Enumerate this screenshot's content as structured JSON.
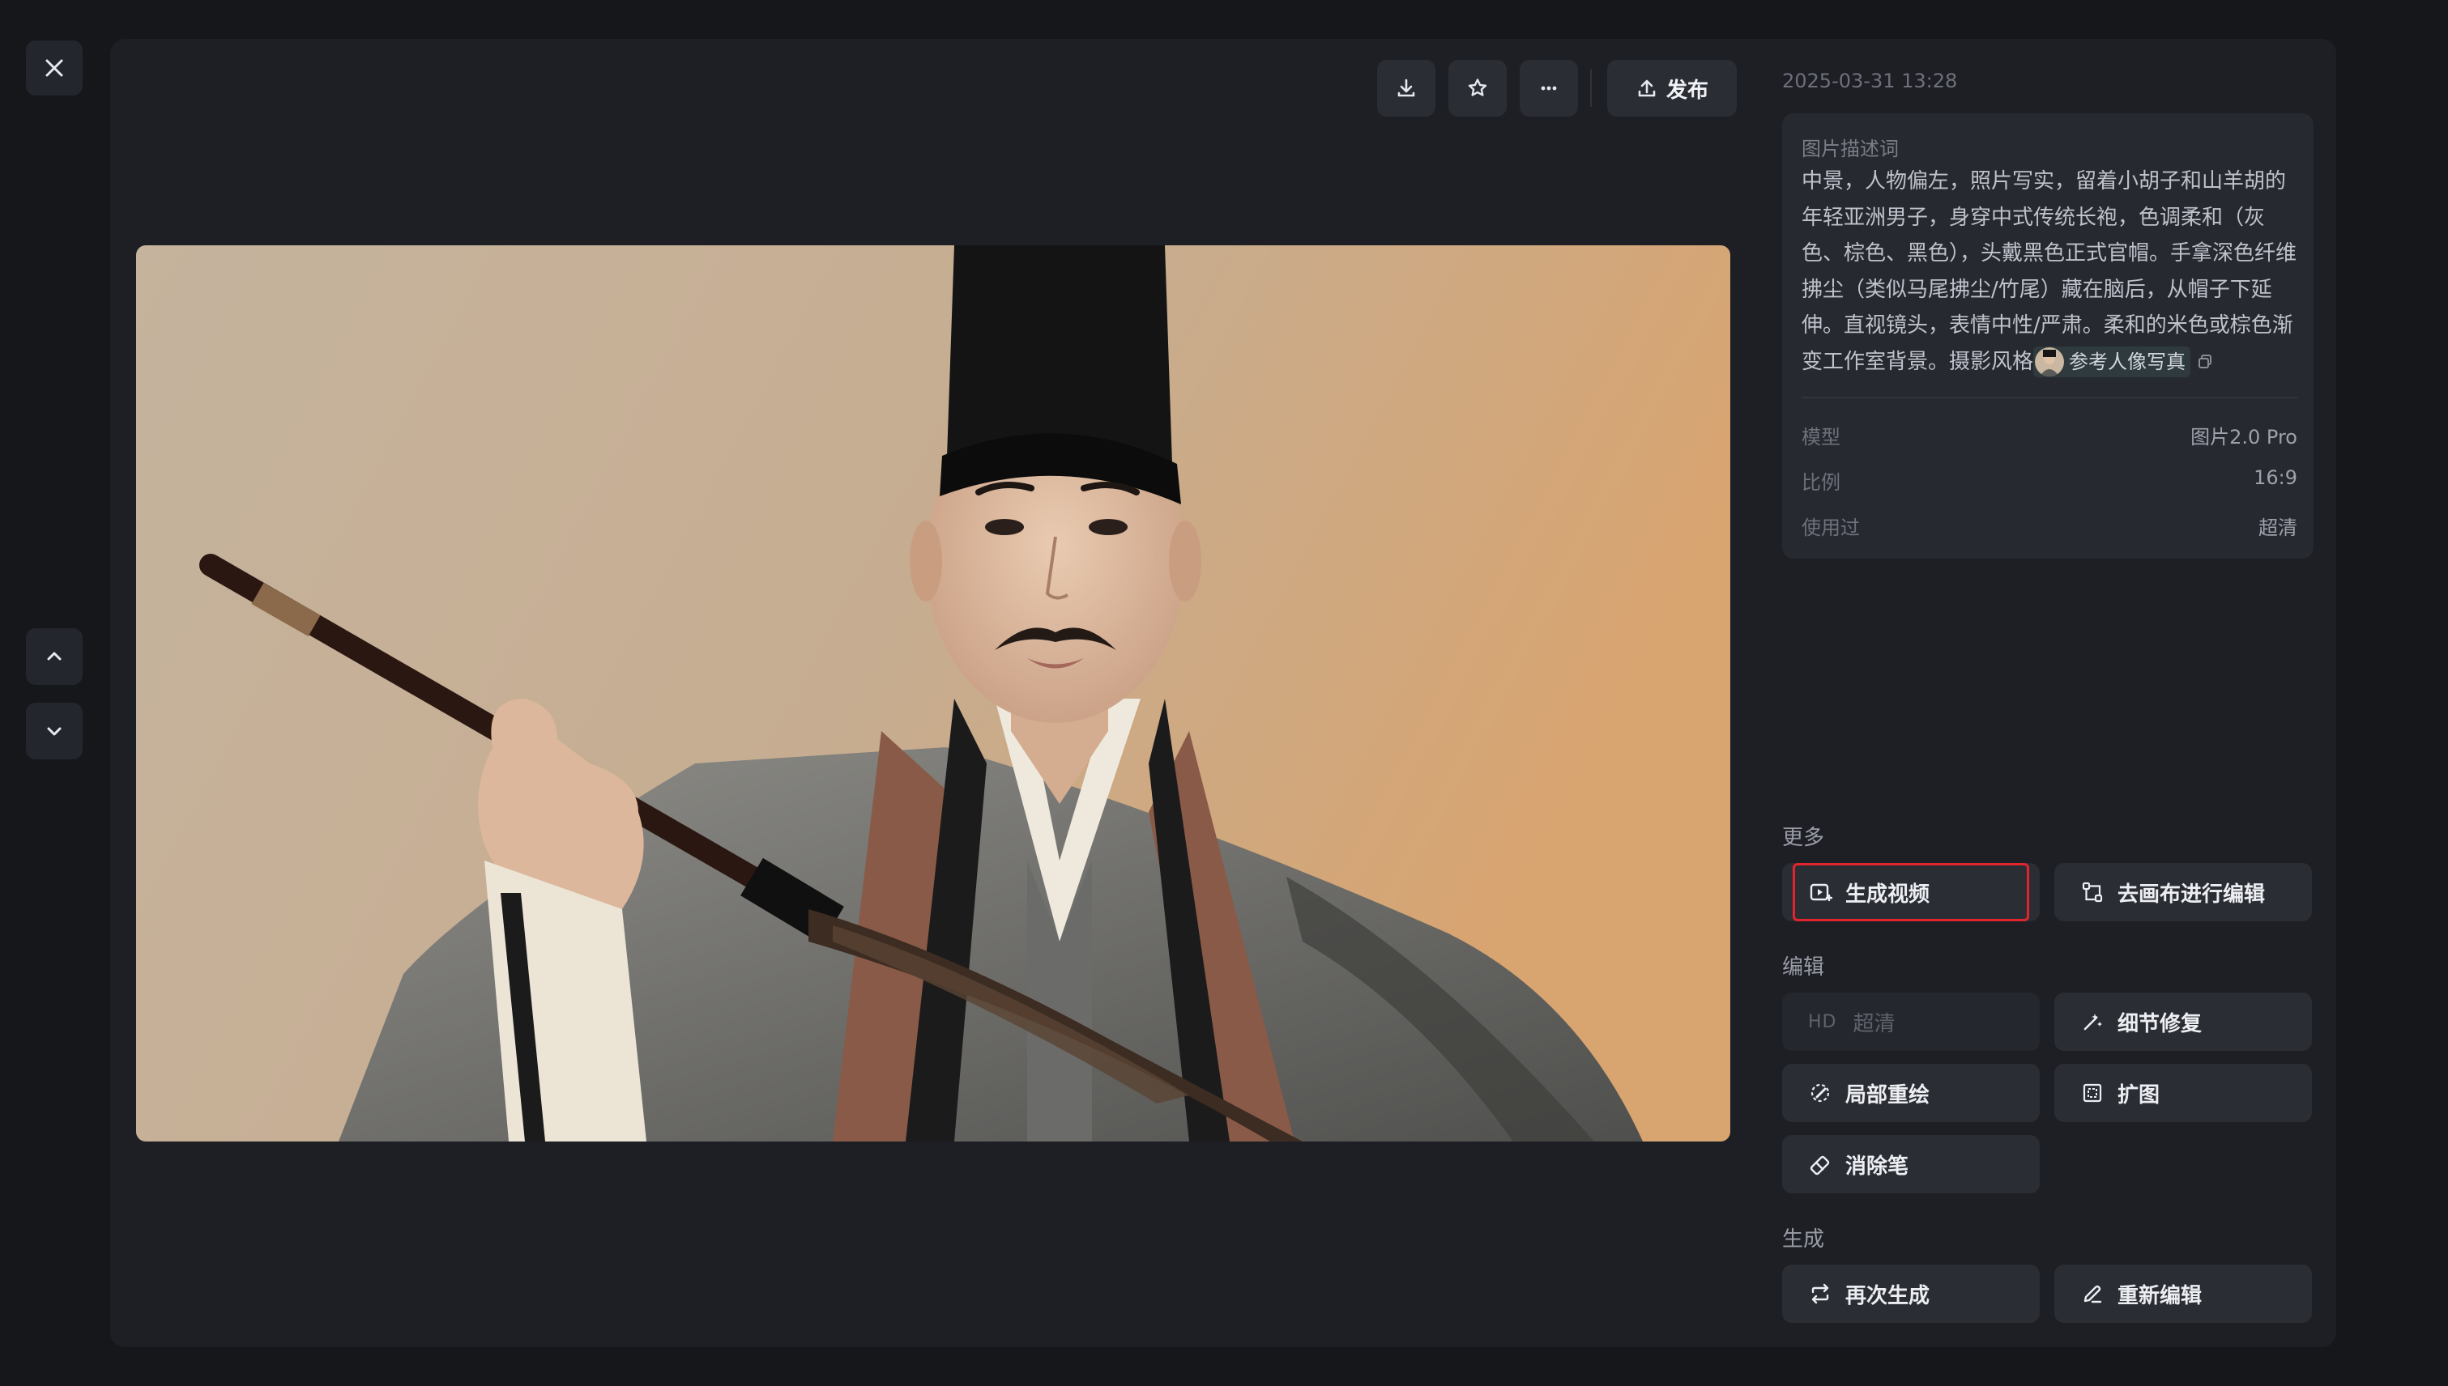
{
  "window": {
    "close_icon": "close-icon",
    "nav_up_icon": "chevron-up-icon",
    "nav_down_icon": "chevron-down-icon"
  },
  "toolbar": {
    "download_icon": "download-icon",
    "favorite_icon": "star-icon",
    "more_icon": "more-icon",
    "publish_label": "发布"
  },
  "image": {
    "subject": "portrait of a young man with a mustache and goatee, wearing a traditional Chinese long robe and a black official hat, holding a horsetail whisk behind his head, on a warm beige studio background"
  },
  "info": {
    "timestamp": "2025-03-31 13:28",
    "desc_title": "图片描述词",
    "description": "中景，人物偏左，照片写实，留着小胡子和山羊胡的年轻亚洲男子，身穿中式传统长袍，色调柔和（灰色、棕色、黑色），头戴黑色正式官帽。手拿深色纤维拂尘（类似马尾拂尘/竹尾）藏在脑后，从帽子下延伸。直视镜头，表情中性/严肃。柔和的米色或棕色渐变工作室背景。摄影风格",
    "reference_chip": "参考人像写真",
    "rows": [
      {
        "key": "模型",
        "value": "图片2.0 Pro"
      },
      {
        "key": "比例",
        "value": "16:9"
      },
      {
        "key": "使用过",
        "value": "超清"
      }
    ]
  },
  "sections": {
    "more": "更多",
    "edit": "编辑",
    "generate": "生成"
  },
  "actions": {
    "generate_video": "生成视频",
    "canvas_edit": "去画布进行编辑",
    "hd_tag": "HD",
    "upscale": "超清",
    "detail_fix": "细节修复",
    "inpaint": "局部重绘",
    "expand": "扩图",
    "eraser": "消除笔",
    "regenerate": "再次生成",
    "reedit": "重新编辑"
  },
  "colors": {
    "background": "#16171b",
    "panel": "#1d1f25",
    "button": "#2b2d35",
    "highlight": "#e2242c"
  }
}
